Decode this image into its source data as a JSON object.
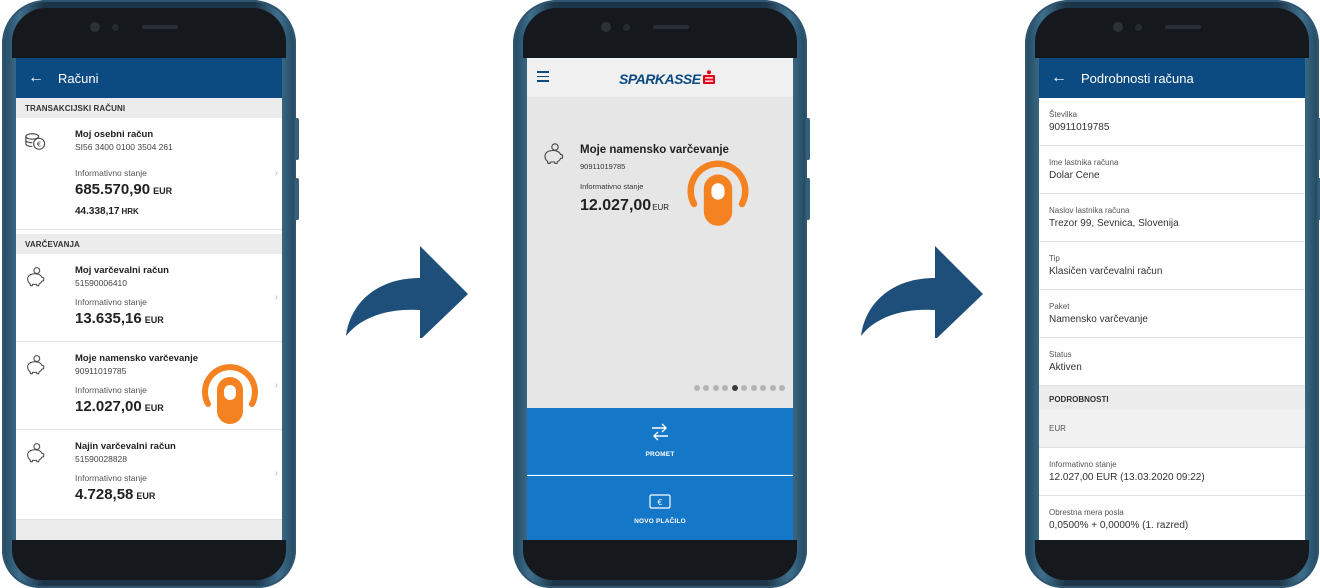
{
  "phone1": {
    "header_title": "Računi",
    "sections": [
      {
        "title": "TRANSAKCIJSKI RAČUNI"
      },
      {
        "title": "VARČEVANJA"
      }
    ],
    "accounts": [
      {
        "name": "Moj osebni račun",
        "number": "SI56 3400 0100 3504 261",
        "balance_label": "Informativno stanje",
        "amount": "685.570,90",
        "currency": "EUR",
        "amount2": "44.338,17",
        "currency2": "HRK"
      },
      {
        "name": "Moj varčevalni račun",
        "number": "51590006410",
        "balance_label": "Informativno stanje",
        "amount": "13.635,16",
        "currency": "EUR"
      },
      {
        "name": "Moje namensko varčevanje",
        "number": "90911019785",
        "balance_label": "Informativno stanje",
        "amount": "12.027,00",
        "currency": "EUR"
      },
      {
        "name": "Najin varčevalni račun",
        "number": "51590028828",
        "balance_label": "Informativno stanje",
        "amount": "4.728,58",
        "currency": "EUR"
      }
    ]
  },
  "phone2": {
    "logo": "SPARKASSE",
    "account_name": "Moje namensko varčevanje",
    "account_number": "90911019785",
    "balance_label": "Informativno stanje",
    "amount": "12.027,00",
    "currency": "EUR",
    "pager": {
      "count": 10,
      "active": 4
    },
    "actions": [
      {
        "label": "PROMET",
        "icon": "transfer-arrows-icon"
      },
      {
        "label": "NOVO PLAČILO",
        "icon": "payment-card-icon"
      }
    ]
  },
  "phone3": {
    "header_title": "Podrobnosti računa",
    "rows": [
      {
        "label": "Številka",
        "value": "90911019785"
      },
      {
        "label": "Ime lastnika računa",
        "value": "Dolar Cene"
      },
      {
        "label": "Naslov lastnika računa",
        "value": "Trezor 99, Sevnica, Slovenija"
      },
      {
        "label": "Tip",
        "value": "Klasičen varčevalni račun"
      },
      {
        "label": "Paket",
        "value": "Namensko varčevanje"
      },
      {
        "label": "Status",
        "value": "Aktiven"
      }
    ],
    "section_title": "PODROBNOSTI",
    "currency_header": "EUR",
    "detail_rows": [
      {
        "label": "Informativno stanje",
        "value": "12.027,00 EUR (13.03.2020 09:22)"
      },
      {
        "label": "Obrestna mera posla",
        "value": "0,0500% + 0,0000% (1. razred)"
      }
    ]
  },
  "colors": {
    "brand_blue": "#0c4a82",
    "action_blue": "#1477c8",
    "tap_orange": "#f58220",
    "arrow_blue": "#1e4f7a"
  }
}
